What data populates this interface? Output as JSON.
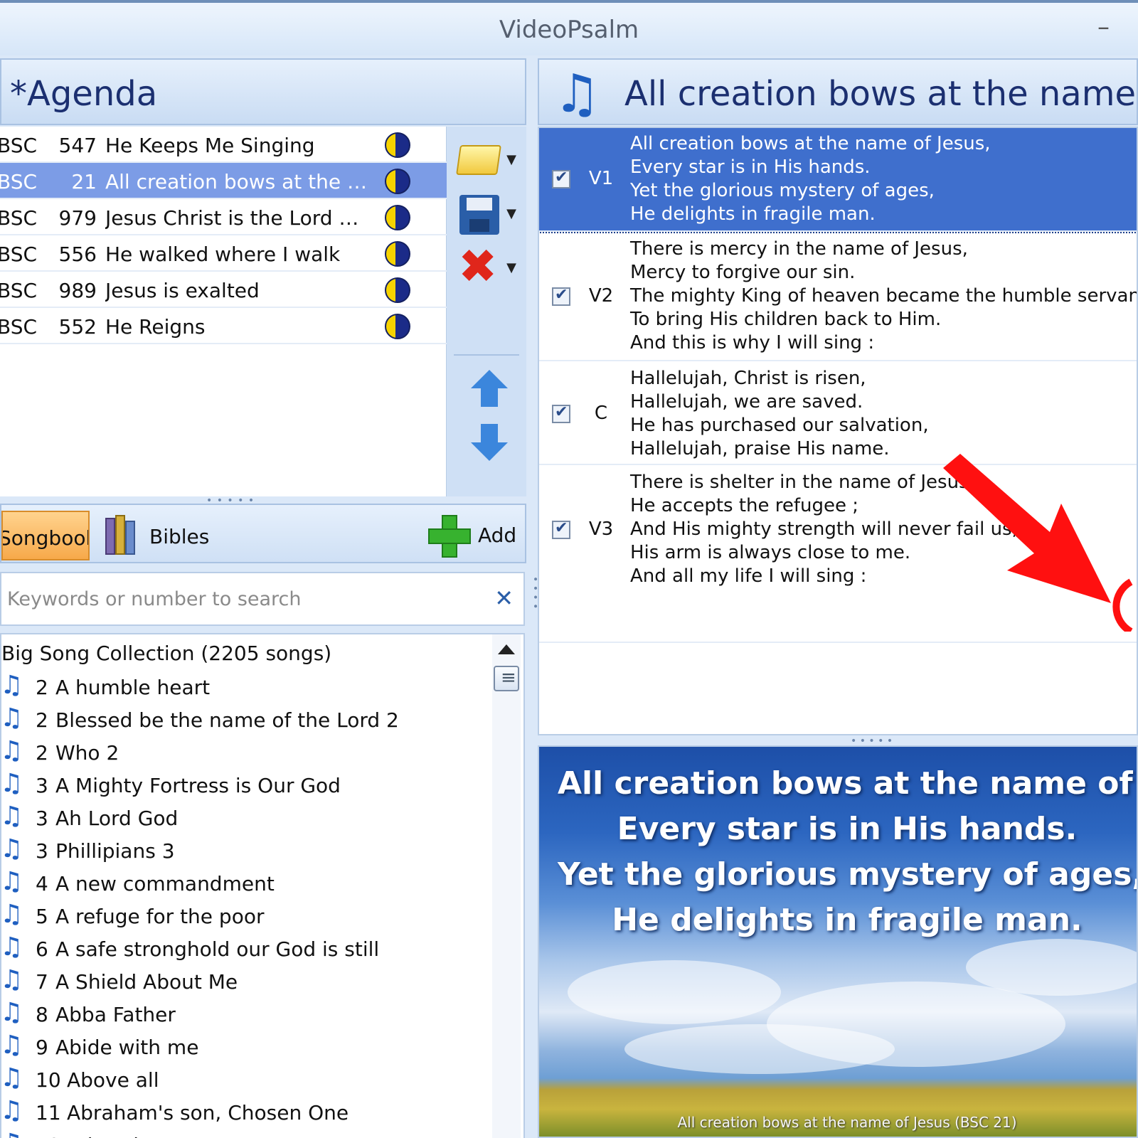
{
  "window": {
    "title": "VideoPsalm",
    "minimize": "–"
  },
  "agenda": {
    "title": "*Agenda",
    "rows": [
      {
        "book": "BSC",
        "number": "547",
        "title": "He Keeps Me Singing"
      },
      {
        "book": "BSC",
        "number": "21",
        "title": "All creation bows at the na…"
      },
      {
        "book": "BSC",
        "number": "979",
        "title": "Jesus Christ is the Lord of all"
      },
      {
        "book": "BSC",
        "number": "556",
        "title": "He walked where I walk"
      },
      {
        "book": "BSC",
        "number": "989",
        "title": "Jesus is exalted"
      },
      {
        "book": "BSC",
        "number": "552",
        "title": "He Reigns"
      }
    ]
  },
  "tabs": {
    "songbooks": "Songbooks",
    "bibles": "Bibles",
    "add": "Add"
  },
  "search": {
    "placeholder": "Keywords or number to search",
    "clear": "✕"
  },
  "collection": {
    "header": "Big Song Collection (2205 songs)",
    "songs": [
      {
        "number": "2",
        "title": "A humble heart"
      },
      {
        "number": "2",
        "title": "Blessed be the name of the Lord 2"
      },
      {
        "number": "2",
        "title": "Who 2"
      },
      {
        "number": "3",
        "title": "A Mighty Fortress is Our God"
      },
      {
        "number": "3",
        "title": "Ah Lord God"
      },
      {
        "number": "3",
        "title": "Phillipians 3"
      },
      {
        "number": "4",
        "title": "A new commandment"
      },
      {
        "number": "5",
        "title": "A refuge for the poor"
      },
      {
        "number": "6",
        "title": "A safe stronghold our God is still"
      },
      {
        "number": "7",
        "title": "A Shield About Me"
      },
      {
        "number": "8",
        "title": "Abba Father"
      },
      {
        "number": "9",
        "title": "Abide with me"
      },
      {
        "number": "10",
        "title": "Above all"
      },
      {
        "number": "11",
        "title": "Abraham's son, Chosen One"
      },
      {
        "number": "12",
        "title": "Adoration"
      }
    ]
  },
  "song": {
    "title": "All creation bows at the name of Jesus",
    "verses": [
      {
        "label": "V1",
        "lines": [
          "All creation bows at the name of Jesus,",
          "Every star is in His hands.",
          "Yet the glorious mystery of ages,",
          "He delights in fragile man."
        ]
      },
      {
        "label": "V2",
        "lines": [
          "There is mercy in the name of Jesus,",
          "Mercy to forgive our sin.",
          "The mighty King of heaven became the humble servant,",
          "To bring His children back to Him.",
          "And this is why I will sing :"
        ]
      },
      {
        "label": "C",
        "lines": [
          "Hallelujah, Christ is risen,",
          "Hallelujah, we are saved.",
          "He has purchased our salvation,",
          "Hallelujah, praise His name."
        ]
      },
      {
        "label": "V3",
        "lines": [
          "There is shelter in the name of Jesus,",
          "He accepts the refugee ;",
          "And His mighty strength will never fail us,",
          "His arm is always close to me.",
          "And all my life I will sing :"
        ]
      }
    ]
  },
  "preview": {
    "lines": [
      "All creation bows at the name of Jesus,",
      "Every star is in His hands.",
      "Yet the glorious mystery of ages,",
      "He delights in fragile man."
    ],
    "caption": "All creation bows at the name of Jesus (BSC 21)"
  },
  "colors": {
    "selected_row": "#7c9ce6",
    "selected_verse": "#3f6fcd",
    "accent": "#1b2f70",
    "annotation_arrow": "#ff1010"
  },
  "icons": [
    "moon-icon",
    "folder-icon",
    "save-icon",
    "delete-icon",
    "up-arrow-icon",
    "down-arrow-icon",
    "books-icon",
    "plus-icon",
    "music-note-icon",
    "close-icon"
  ]
}
